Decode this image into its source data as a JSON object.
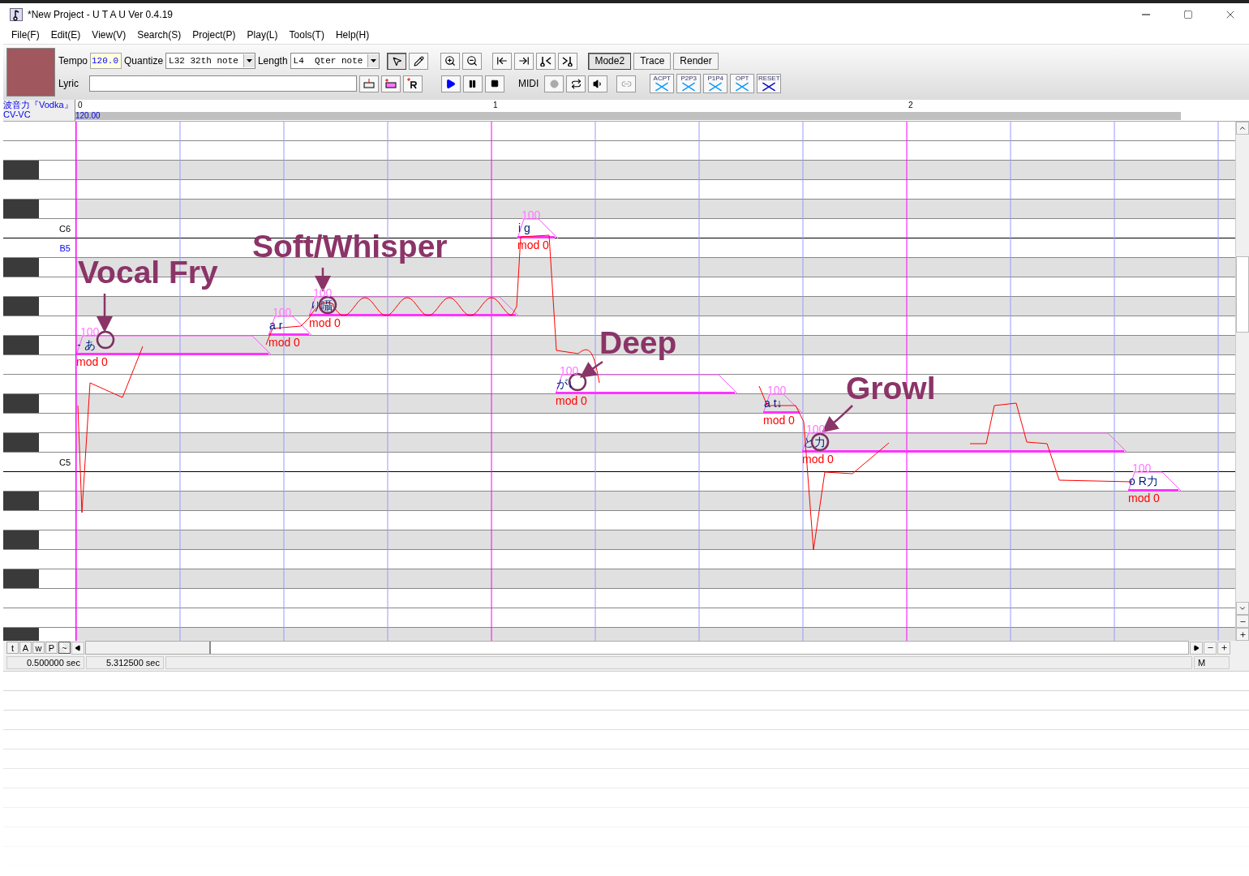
{
  "window": {
    "title": "*New Project - U T A U Ver 0.4.19"
  },
  "menu": [
    "File(F)",
    "Edit(E)",
    "View(V)",
    "Search(S)",
    "Project(P)",
    "Play(L)",
    "Tools(T)",
    "Help(H)"
  ],
  "toolbar": {
    "tempo_label": "Tempo",
    "tempo": "120.0",
    "quantize_label": "Quantize",
    "quantize": "L32 32th note",
    "length_label": "Length",
    "length": "L4  Qter note",
    "lyric_label": "Lyric",
    "midi_label": "MIDI",
    "tools": [
      {
        "kind": "pointer",
        "selected": true
      },
      {
        "kind": "pencil",
        "selected": false
      }
    ],
    "modes": [
      {
        "label": "Mode2",
        "selected": true
      },
      {
        "label": "Trace",
        "selected": false
      },
      {
        "label": "Render",
        "selected": false
      }
    ],
    "midi_buttons": [
      {
        "kind": "record",
        "disabled": true
      },
      {
        "kind": "loop",
        "disabled": false
      },
      {
        "kind": "speaker",
        "disabled": false
      },
      {
        "kind": "link",
        "disabled": true
      }
    ],
    "pitch_tools": [
      "ACPT",
      "P2P3",
      "P1P4",
      "OPT",
      "RESET"
    ]
  },
  "track": {
    "singer": "波音力『Vodka』",
    "voicebank": "CV-VC",
    "tempo": "120.00",
    "measures": [
      "0",
      "1",
      "2"
    ]
  },
  "keys": [
    {
      "label": "C6",
      "kind": "octave"
    },
    {
      "label": "B5",
      "kind": "cursor"
    },
    {
      "label": "C5",
      "kind": "octave"
    }
  ],
  "notes": [
    {
      "lyric": "- あ",
      "velocity": "100",
      "modulation": "mod 0"
    },
    {
      "lyric": "a r",
      "velocity": "100",
      "modulation": "mod 0"
    },
    {
      "lyric": "り囁",
      "velocity": "100",
      "modulation": "mod 0"
    },
    {
      "lyric": "i g",
      "velocity": "100",
      "modulation": "mod 0"
    },
    {
      "lyric": "が↓",
      "velocity": "100",
      "modulation": "mod 0"
    },
    {
      "lyric": "a t↓",
      "velocity": "100",
      "modulation": "mod 0"
    },
    {
      "lyric": "と力",
      "velocity": "100",
      "modulation": "mod 0"
    },
    {
      "lyric": "o R力",
      "velocity": "100",
      "modulation": "mod 0"
    }
  ],
  "annotations": [
    {
      "text": "Vocal Fry"
    },
    {
      "text": "Soft/Whisper"
    },
    {
      "text": "Deep"
    },
    {
      "text": "Growl"
    }
  ],
  "lower_tabs": [
    {
      "label": "t",
      "selected": false
    },
    {
      "label": "A",
      "selected": false
    },
    {
      "label": "w",
      "selected": false
    },
    {
      "label": "P",
      "selected": false
    },
    {
      "label": "~",
      "selected": true
    }
  ],
  "status": {
    "position": "0.500000 sec",
    "length": "5.312500 sec",
    "mode": "M"
  }
}
